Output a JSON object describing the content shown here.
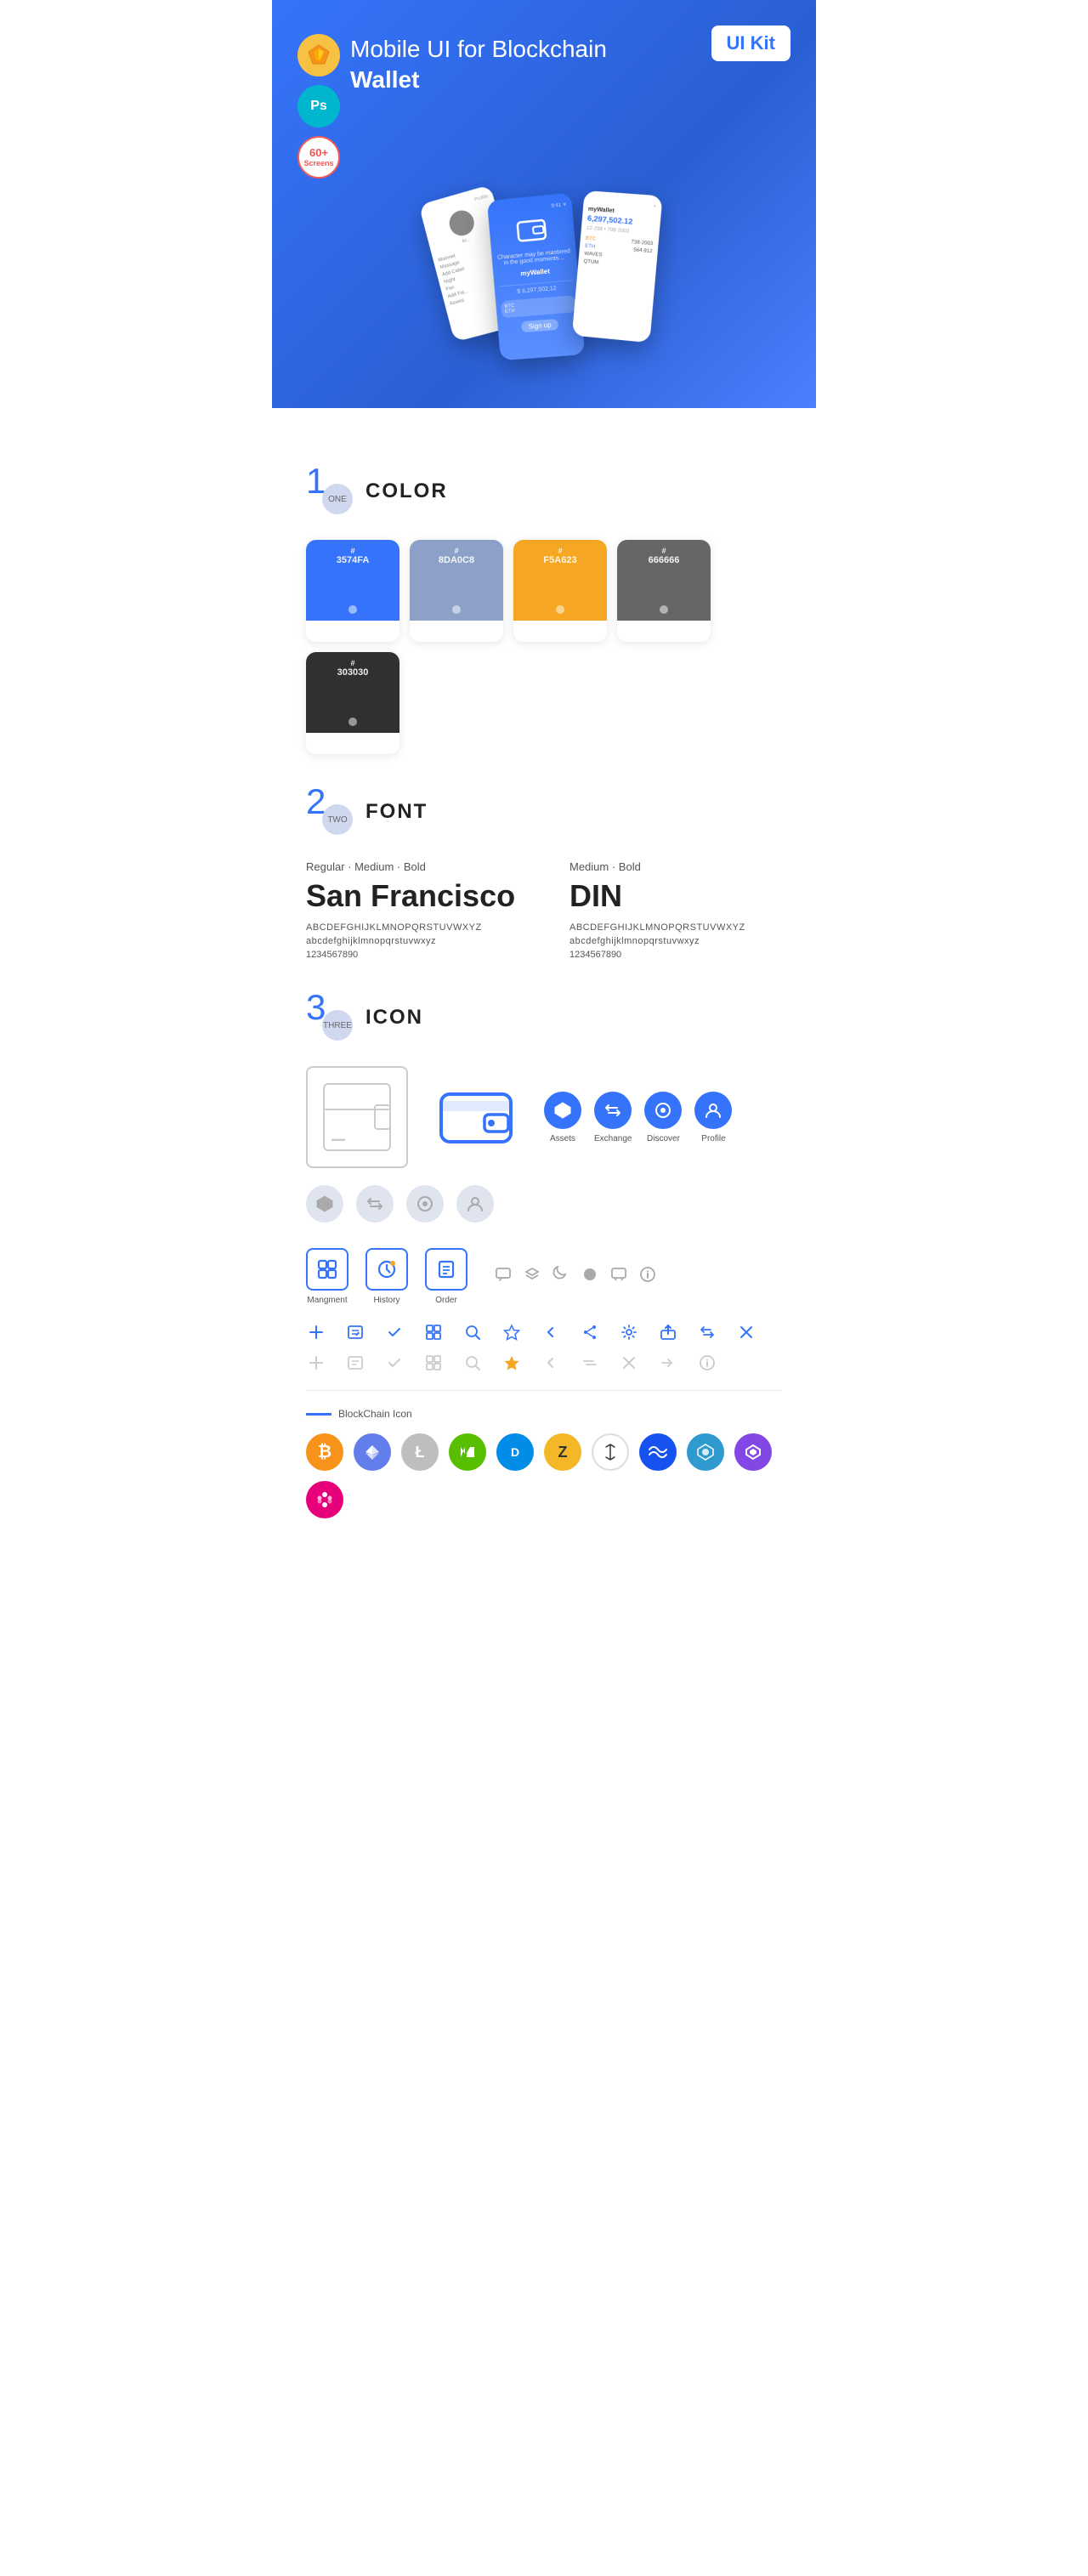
{
  "hero": {
    "title": "Mobile UI for Blockchain ",
    "title_bold": "Wallet",
    "badge": "UI Kit",
    "badges": [
      {
        "id": "sketch",
        "label": "Sk"
      },
      {
        "id": "ps",
        "label": "Ps"
      },
      {
        "id": "screens",
        "line1": "60+",
        "line2": "Screens"
      }
    ]
  },
  "sections": {
    "color": {
      "number": "1",
      "word": "ONE",
      "title": "COLOR",
      "swatches": [
        {
          "hex": "#3574FA",
          "code": "#3574FA",
          "label": "3574FA"
        },
        {
          "hex": "#8DA0C8",
          "code": "#8DA0C8",
          "label": "8DA0C8"
        },
        {
          "hex": "#F5A623",
          "code": "#F5A623",
          "label": "F5A623"
        },
        {
          "hex": "#666666",
          "code": "#666666",
          "label": "666666"
        },
        {
          "hex": "#303030",
          "code": "#303030",
          "label": "303030"
        }
      ]
    },
    "font": {
      "number": "2",
      "word": "TWO",
      "title": "FONT",
      "fonts": [
        {
          "style_label": "Regular · Medium · Bold",
          "name": "San Francisco",
          "uppercase": "ABCDEFGHIJKLMNOPQRSTUVWXYZ",
          "lowercase": "abcdefghijklmnopqrstuvwxyz",
          "numbers": "1234567890",
          "is_bold": true
        },
        {
          "style_label": "Medium · Bold",
          "name": "DIN",
          "uppercase": "ABCDEFGHIJKLMNOPQRSTUVWXYZ",
          "lowercase": "abcdefghijklmnopqrstuvwxyz",
          "numbers": "1234567890",
          "is_bold": false
        }
      ]
    },
    "icon": {
      "number": "3",
      "word": "THREE",
      "title": "ICON",
      "nav_icons": [
        {
          "label": "Assets",
          "unicode": "◆",
          "active": true
        },
        {
          "label": "Exchange",
          "unicode": "⇄",
          "active": true
        },
        {
          "label": "Discover",
          "unicode": "●",
          "active": true
        },
        {
          "label": "Profile",
          "unicode": "◑",
          "active": true
        }
      ],
      "nav_icons_grey": [
        {
          "label": "",
          "unicode": "◆"
        },
        {
          "label": "",
          "unicode": "⇄"
        },
        {
          "label": "",
          "unicode": "●"
        },
        {
          "label": "",
          "unicode": "◑"
        }
      ],
      "bottom_icons": [
        {
          "label": "Mangment",
          "unicode": "⊞"
        },
        {
          "label": "History",
          "unicode": "⏱"
        },
        {
          "label": "Order",
          "unicode": "≡"
        }
      ],
      "small_icons_active": [
        "+",
        "⊟",
        "✓",
        "⊞",
        "⌕",
        "☆",
        "‹",
        "≺",
        "⚙",
        "⊠",
        "⇄",
        "✕"
      ],
      "small_icons_grey": [
        "+",
        "⊟",
        "✓",
        "⊞",
        "⌕",
        "☆",
        "‹",
        "≺",
        "⊠",
        "⇄",
        "ℹ"
      ],
      "blockchain_label": "BlockChain Icon",
      "crypto": [
        {
          "symbol": "₿",
          "class": "crypto-btc",
          "name": "Bitcoin"
        },
        {
          "symbol": "Ξ",
          "class": "crypto-eth",
          "name": "Ethereum"
        },
        {
          "symbol": "Ł",
          "class": "crypto-ltc",
          "name": "Litecoin"
        },
        {
          "symbol": "N",
          "class": "crypto-neo",
          "name": "NEO"
        },
        {
          "symbol": "D",
          "class": "crypto-dash",
          "name": "Dash"
        },
        {
          "symbol": "Z",
          "class": "crypto-zcash",
          "name": "Zcash"
        },
        {
          "symbol": "⌬",
          "class": "crypto-iota",
          "name": "IOTA"
        },
        {
          "symbol": "W",
          "class": "crypto-waves",
          "name": "Waves"
        },
        {
          "symbol": "Q",
          "class": "crypto-qtum",
          "name": "QTUM"
        },
        {
          "symbol": "◈",
          "class": "crypto-matic",
          "name": "Polygon"
        },
        {
          "symbol": "●",
          "class": "crypto-dot",
          "name": "Polkadot"
        }
      ]
    }
  }
}
